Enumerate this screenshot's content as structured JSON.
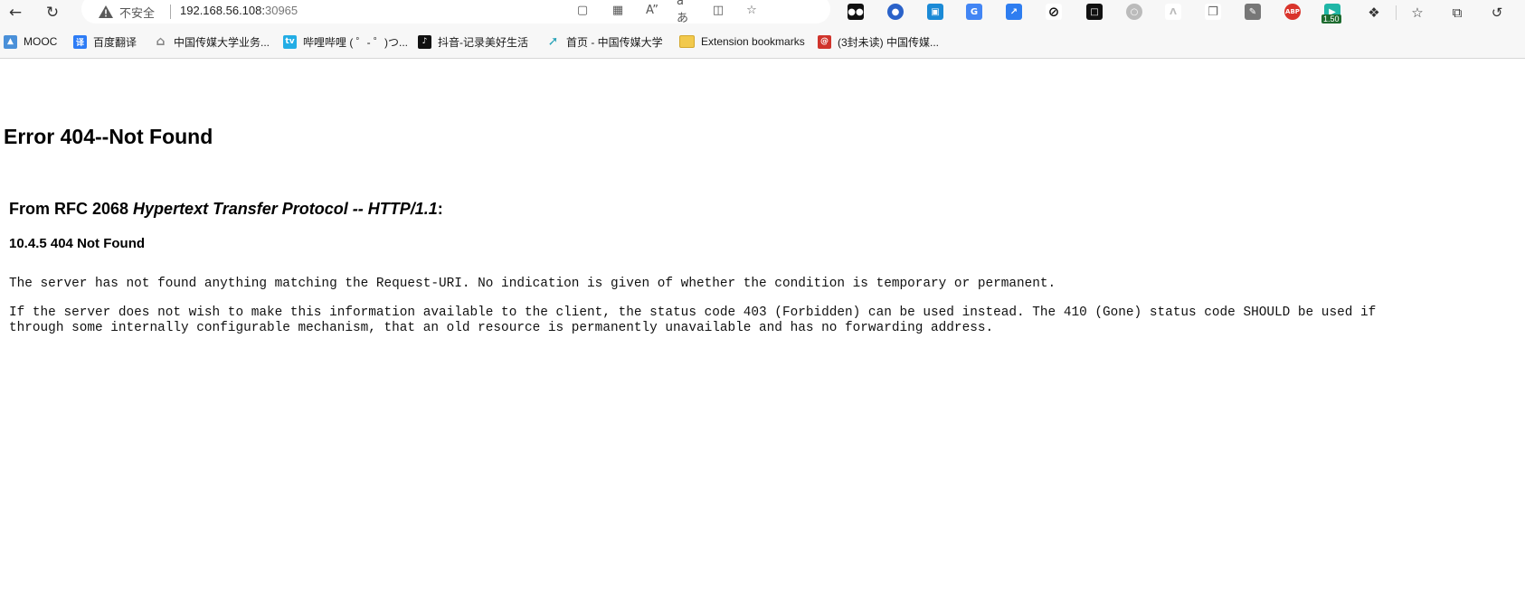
{
  "browser": {
    "address_bar": {
      "security_label": "不安全",
      "url_host": "192.168.56.108:",
      "url_port": "30965"
    },
    "bookmarks": [
      {
        "label": "MOOC",
        "icon": "mooc-icon",
        "color": "#4a90d9"
      },
      {
        "label": "百度翻译",
        "icon": "baidu-translate-icon",
        "color": "#2d7cf6"
      },
      {
        "label": "中国传媒大学业务...",
        "icon": "home-icon",
        "color": "#888888"
      },
      {
        "label": "哔哩哔哩 ( ゜- ゜)つ...",
        "icon": "bilibili-icon",
        "color": "#23ade5"
      },
      {
        "label": "抖音-记录美好生活",
        "icon": "douyin-icon",
        "color": "#111111"
      },
      {
        "label": "首页 - 中国传媒大学",
        "icon": "cuc-icon",
        "color": "#2aa3b8"
      },
      {
        "label": "Extension bookmarks",
        "icon": "folder-icon",
        "color": "#e8b923"
      },
      {
        "label": "(3封未读) 中国传媒...",
        "icon": "mail-icon",
        "color": "#d0342c"
      }
    ],
    "extension_badge": "1.50"
  },
  "page": {
    "title": "Error 404--Not Found",
    "rfc_prefix": "From RFC 2068 ",
    "rfc_title": "Hypertext Transfer Protocol -- HTTP/1.1",
    "rfc_suffix": ":",
    "section": "10.4.5 404 Not Found",
    "paragraph1": "The server has not found anything matching the Request-URI. No indication is given of whether the condition is temporary or permanent.",
    "paragraph2_line1": "If the server does not wish to make this information available to the client, the status code 403 (Forbidden) can be used instead. The 410 (Gone) status code SHOULD be used if",
    "paragraph2_line2": "through some internally configurable mechanism, that an old resource is permanently unavailable and has no forwarding address."
  }
}
